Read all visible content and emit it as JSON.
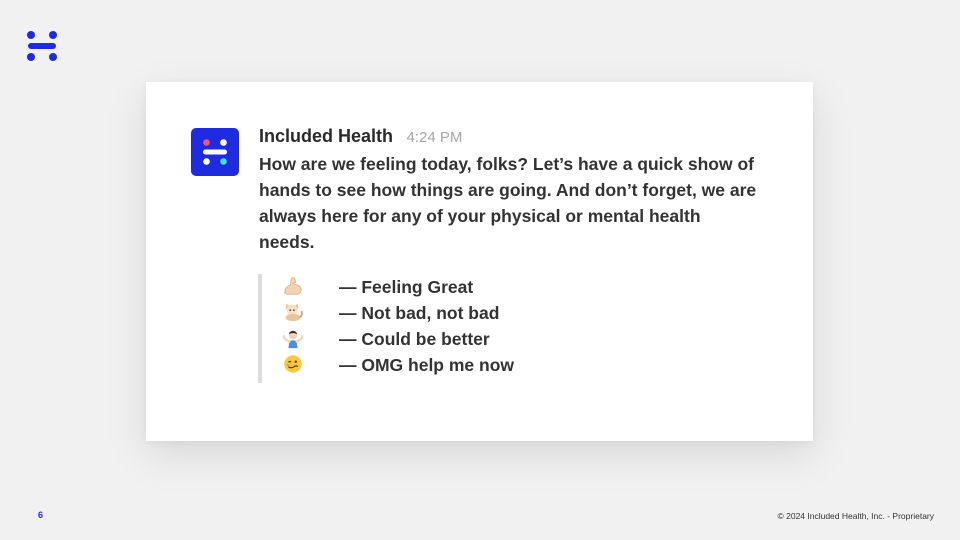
{
  "brand": {
    "accent_color": "#1f2be0"
  },
  "message": {
    "sender": "Included Health",
    "time": "4:24 PM",
    "text": "How are we feeling today, folks? Let’s have a quick show of hands to see how things are going. And don’t forget, we are always here for any of your physical or mental health needs."
  },
  "poll": {
    "options": [
      {
        "icon": "flexed-biceps-emoji-icon",
        "label": "— Feeling Great"
      },
      {
        "icon": "cat-emoji-icon",
        "label": "— Not bad, not bad"
      },
      {
        "icon": "person-shrugging-emoji-icon",
        "label": "— Could be better"
      },
      {
        "icon": "woozy-face-emoji-icon",
        "label": "— OMG help me now"
      }
    ]
  },
  "footer": {
    "page_number": "6",
    "copyright": "© 2024 Included Health, Inc. - Proprietary"
  }
}
